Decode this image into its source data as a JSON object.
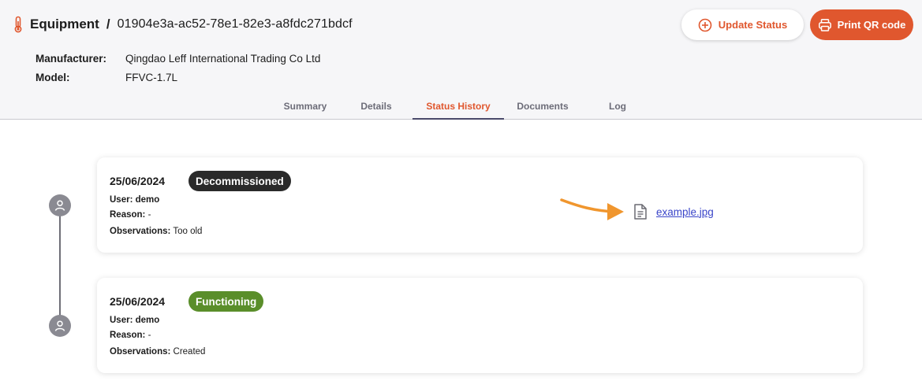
{
  "header": {
    "title": "Equipment",
    "separator": "/",
    "equipment_id": "01904e3a-ac52-78e1-82e3-a8fdc271bdcf",
    "update_status_label": "Update Status",
    "print_qr_label": "Print QR code",
    "manufacturer_label": "Manufacturer:",
    "manufacturer_value": "Qingdao Leff International Trading Co Ltd",
    "model_label": "Model:",
    "model_value": "FFVC-1.7L"
  },
  "tabs": [
    {
      "label": "Summary",
      "active": false
    },
    {
      "label": "Details",
      "active": false
    },
    {
      "label": "Status History",
      "active": true
    },
    {
      "label": "Documents",
      "active": false
    },
    {
      "label": "Log",
      "active": false
    }
  ],
  "history": [
    {
      "date": "25/06/2024",
      "status": "Decommissioned",
      "status_color": "#2a2a2a",
      "user_label": "User:",
      "user": "demo",
      "reason_label": "Reason:",
      "reason": "-",
      "observations_label": "Observations:",
      "observations": "Too old",
      "attachment": "example.jpg"
    },
    {
      "date": "25/06/2024",
      "status": "Functioning",
      "status_color": "#5a8e2a",
      "user_label": "User:",
      "user": "demo",
      "reason_label": "Reason:",
      "reason": "-",
      "observations_label": "Observations:",
      "observations": "Created"
    }
  ],
  "colors": {
    "accent": "#e0572e",
    "link": "#3a45c9",
    "annotation_arrow": "#f0962e"
  },
  "icons": [
    "thermometer-icon",
    "plus-circle-icon",
    "printer-icon",
    "user-icon",
    "document-icon",
    "annotation-arrow"
  ]
}
